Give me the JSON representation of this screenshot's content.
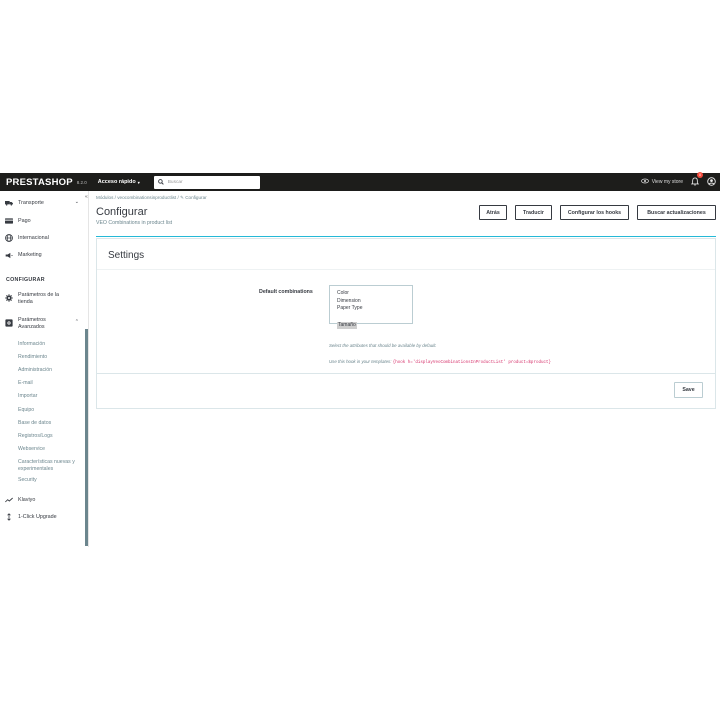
{
  "topbar": {
    "logo": "PRESTASHOP",
    "version": "8.2.0",
    "quick_access": "Acceso rápido",
    "search_placeholder": "Buscar",
    "view_store": "View my store",
    "notifications_count": "0"
  },
  "sidebar": {
    "items_top": [
      {
        "label": "Transporte",
        "icon": "truck-icon"
      },
      {
        "label": "Pago",
        "icon": "credit-card-icon"
      },
      {
        "label": "Internacional",
        "icon": "globe-icon"
      },
      {
        "label": "Marketing",
        "icon": "megaphone-icon"
      }
    ],
    "section_configure": "CONFIGURAR",
    "config_items": [
      {
        "label": "Parámetros de la tienda",
        "icon": "gear-icon"
      },
      {
        "label": "Parámetros Avanzados",
        "icon": "settings-box-icon"
      }
    ],
    "sub_items": [
      "Información",
      "Rendimiento",
      "Administración",
      "E-mail",
      "Importar",
      "Equipo",
      "Base de datos",
      "Registros/Logs",
      "Webservice",
      "Características nuevas y experimentales",
      "Security"
    ],
    "items_bottom": [
      {
        "label": "Klaviyo",
        "icon": "trend-icon"
      },
      {
        "label": "1-Click Upgrade",
        "icon": "updown-arrows-icon"
      }
    ]
  },
  "breadcrumb": {
    "parts": [
      "Módulos",
      "veocombinationsinproductlist",
      "Configurar"
    ]
  },
  "header": {
    "title": "Configurar",
    "subtitle": "VEO Combinations in product list",
    "buttons": [
      "Atrás",
      "Traducir",
      "Configurar los hooks",
      "Buscar actualizaciones"
    ]
  },
  "settings": {
    "title": "Settings",
    "field_label": "Default combinations",
    "options": [
      "Color",
      "Dimension",
      "Paper Type",
      "Tamaño"
    ],
    "selected_option": "Tamaño",
    "help_text": "Select the attributes that should be available by default.",
    "hook_text_prefix": "Use this hook in your templates:",
    "hook_code": "{hook h='displayVeoCombinationsInProductList' product=$product}",
    "save_label": "Save"
  },
  "colors": {
    "topbar_bg": "#1d1d1b",
    "accent": "#25b9d7",
    "notification_badge": "#f54c3e"
  }
}
